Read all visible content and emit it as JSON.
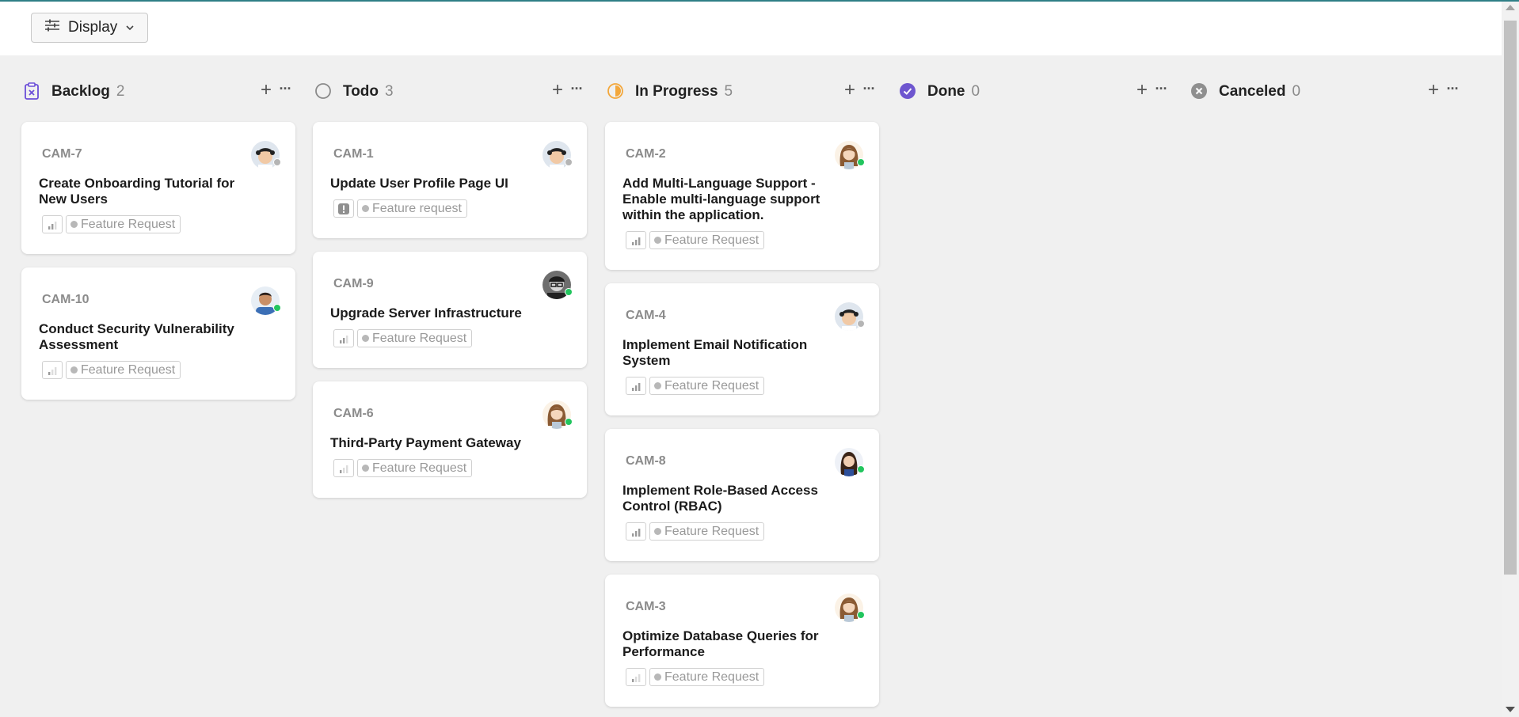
{
  "toolbar": {
    "display_label": "Display"
  },
  "colors": {
    "backlog": "#6b4ed8",
    "todo": "#8a8a8a",
    "in_progress": "#f3a73b",
    "done": "#6e56cf",
    "canceled": "#8f8f8f",
    "status_online": "#22c55e",
    "status_offline": "#b5b5b5"
  },
  "columns": [
    {
      "name": "Backlog",
      "count": "2",
      "icon": "backlog-icon",
      "cards": [
        {
          "id": "CAM-7",
          "title": "Create Onboarding Tutorial for New Users",
          "label": "Feature Request",
          "priority": "medium-priority-icon",
          "avatar": "man-curly-hair",
          "status": "offline"
        },
        {
          "id": "CAM-10",
          "title": "Conduct Security Vulnerability Assessment",
          "label": "Feature Request",
          "priority": "low-priority-icon",
          "avatar": "man-blue-shirt",
          "status": "online"
        }
      ]
    },
    {
      "name": "Todo",
      "count": "3",
      "icon": "todo-circle-icon",
      "cards": [
        {
          "id": "CAM-1",
          "title": "Update User Profile Page UI",
          "label": "Feature request",
          "priority": "urgent-priority-icon",
          "avatar": "man-curly-hair",
          "status": "offline"
        },
        {
          "id": "CAM-9",
          "title": "Upgrade Server Infrastructure",
          "label": "Feature Request",
          "priority": "medium-priority-icon",
          "avatar": "man-glasses-bw",
          "status": "online"
        },
        {
          "id": "CAM-6",
          "title": "Third-Party Payment Gateway",
          "label": "Feature Request",
          "priority": "low-priority-icon",
          "avatar": "woman-long-hair",
          "status": "online"
        }
      ]
    },
    {
      "name": "In Progress",
      "count": "5",
      "icon": "in-progress-icon",
      "cards": [
        {
          "id": "CAM-2",
          "title": "Add Multi-Language Support - Enable multi-language support within the application.",
          "label": "Feature Request",
          "priority": "high-priority-icon",
          "avatar": "woman-long-hair",
          "status": "online"
        },
        {
          "id": "CAM-4",
          "title": "Implement Email Notification System",
          "label": "Feature Request",
          "priority": "high-priority-icon",
          "avatar": "man-curly-hair",
          "status": "offline"
        },
        {
          "id": "CAM-8",
          "title": "Implement Role-Based Access Control (RBAC)",
          "label": "Feature Request",
          "priority": "high-priority-icon",
          "avatar": "woman-dark-hair",
          "status": "online"
        },
        {
          "id": "CAM-3",
          "title": "Optimize Database Queries for Performance",
          "label": "Feature Request",
          "priority": "low-priority-icon",
          "avatar": "woman-long-hair",
          "status": "online"
        }
      ]
    },
    {
      "name": "Done",
      "count": "0",
      "icon": "done-check-icon",
      "cards": []
    },
    {
      "name": "Canceled",
      "count": "0",
      "icon": "canceled-x-icon",
      "cards": []
    }
  ]
}
